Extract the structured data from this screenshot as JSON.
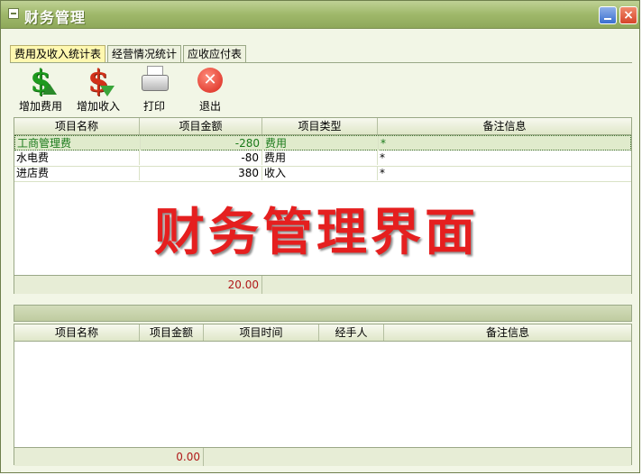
{
  "window": {
    "title": "财务管理",
    "close_glyph": "×"
  },
  "tabs": [
    {
      "label": "费用及收入统计表",
      "active": true
    },
    {
      "label": "经营情况统计",
      "active": false
    },
    {
      "label": "应收应付表",
      "active": false
    }
  ],
  "toolbar": {
    "add_expense": {
      "label": "增加费用",
      "icon": "dollar-up-icon"
    },
    "add_income": {
      "label": "增加收入",
      "icon": "dollar-down-icon"
    },
    "print": {
      "label": "打印",
      "icon": "printer-icon"
    },
    "exit": {
      "label": "退出",
      "icon": "close-circle-icon",
      "glyph": "✕"
    }
  },
  "table1": {
    "headers": [
      "项目名称",
      "项目金额",
      "项目类型",
      "备注信息"
    ],
    "rows": [
      {
        "name": "工商管理费",
        "amount": "-280",
        "type": "费用",
        "note": "*"
      },
      {
        "name": "水电费",
        "amount": "-80",
        "type": "费用",
        "note": "*"
      },
      {
        "name": "进店费",
        "amount": "380",
        "type": "收入",
        "note": "*"
      }
    ],
    "total": "20.00"
  },
  "overlay_text": "财务管理界面",
  "table2": {
    "headers": [
      "项目名称",
      "项目金额",
      "项目时间",
      "经手人",
      "备注信息"
    ],
    "total": "0.00"
  },
  "colors": {
    "selected_row_text": "#1a7a1a",
    "total_text": "#b01818",
    "overlay": "#e51f1f"
  }
}
